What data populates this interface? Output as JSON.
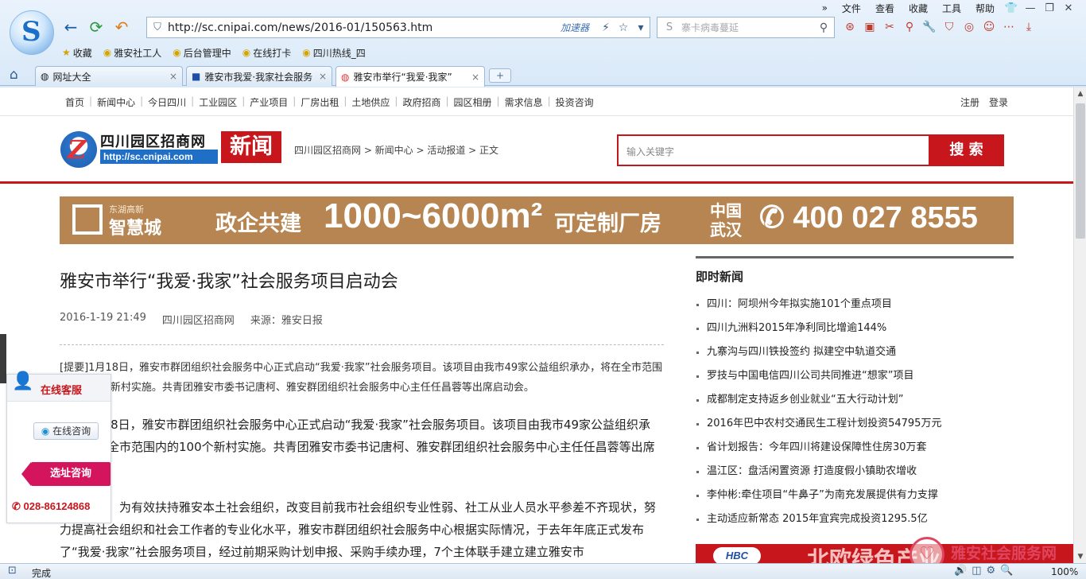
{
  "browser": {
    "menu": {
      "chevrons": "»",
      "file": "文件",
      "view": "查看",
      "favorites": "收藏",
      "tools": "工具",
      "help": "帮助"
    },
    "window_icons": {
      "skin": "👕",
      "minimize": "—",
      "restore": "❐",
      "close": "✕"
    },
    "nav": {
      "back": "←",
      "refresh": "⟳",
      "undo": "↶"
    },
    "address": {
      "url": "http://sc.cnipai.com/news/2016-01/150563.htm",
      "accelerator": "加速器",
      "bolt": "⚡",
      "star": "☆",
      "dropdown": "▾"
    },
    "search": {
      "placeholder": "寨卡病毒蔓延",
      "engine": "S"
    },
    "toolbar_icons": [
      "⊛",
      "▣",
      "✂",
      "⚲",
      "🔧",
      "⛉",
      "◎",
      "☺",
      "⋯",
      "⤓"
    ],
    "favorites_bar": [
      {
        "icon": "★",
        "label": "收藏"
      },
      {
        "icon": "◉",
        "label": "雅安社工人"
      },
      {
        "icon": "◉",
        "label": "后台管理中"
      },
      {
        "icon": "◉",
        "label": "在线打卡"
      },
      {
        "icon": "◉",
        "label": "四川热线_四"
      }
    ],
    "tabs": [
      {
        "icon": "◍",
        "label": "网址大全",
        "close": "×"
      },
      {
        "icon": "■",
        "label": "雅安市我爱·我家社会服务",
        "close": "×"
      },
      {
        "icon": "◍",
        "label": "雅安市举行“我爱·我家”",
        "close": "×"
      }
    ],
    "new_tab": "+",
    "home_icon": "⌂",
    "status": {
      "text": "完成",
      "zoom": "100%",
      "icons": [
        "🔊",
        "◫",
        "⚙",
        "🔍"
      ]
    }
  },
  "site": {
    "topnav": [
      "首页",
      "新闻中心",
      "今日四川",
      "工业园区",
      "产业项目",
      "厂房出租",
      "土地供应",
      "政府招商",
      "园区相册",
      "需求信息",
      "投资咨询"
    ],
    "register": "注册",
    "login": "登录",
    "brand": {
      "letter": "Z",
      "name": "四川园区招商网",
      "url": "http://sc.cnipai.com",
      "news": "新闻"
    },
    "breadcrumb": "四川园区招商网 > 新闻中心 > 活动报道 > 正文",
    "search": {
      "placeholder": "输入关键字",
      "button": "搜 索"
    },
    "banner": {
      "sub": "东湖高新",
      "name": "智慧城",
      "slogan": "政企共建",
      "area": "1000~6000m²",
      "custom": "可定制厂房",
      "location": "中国武汉",
      "phone": "✆ 400 027 8555"
    }
  },
  "article": {
    "title": "雅安市举行“我爱·我家”社会服务项目启动会",
    "date": "2016-1-19 21:49",
    "site": "四川园区招商网",
    "source": "来源：雅安日报",
    "summary_tag": "[提要]",
    "summary": "1月18日，雅安市群团组织社会服务中心正式启动“我爱·我家”社会服务项目。该项目由我市49家公益组织承办，将在全市范围内的100个新村实施。共青团雅安市委书记唐柯、雅安群团组织社会服务中心主任任昌蓉等出席启动会。",
    "p1": "1月18日，雅安市群团组织社会服务中心正式启动“我爱·我家”社会服务项目。该项目由我市49家公益组织承办，将在全市范围内的100个新村实施。共青团雅安市委书记唐柯、雅安群团组织社会服务中心主任任昌蓉等出席启动会。",
    "p2": "据悉，为有效扶持雅安本土社会组织，改变目前我市社会组织专业性弱、社工从业人员水平参差不齐现状，努力提高社会组织和社会工作者的专业化水平，雅安市群团组织社会服务中心根据实际情况，于去年年底正式发布了“我爱·我家”社会服务项目，经过前期采购计划申报、采购手续办理，7个主体联手建立建立雅安市"
  },
  "sidebar": {
    "heading": "即时新闻",
    "news": [
      "四川：阿坝州今年拟实施101个重点项目",
      "四川九洲料2015年净利同比增逾144%",
      "九寨沟与四川铁投签约 拟建空中轨道交通",
      "罗技与中国电信四川公司共同推进“想家”项目",
      "成都制定支持返乡创业就业“五大行动计划”",
      "2016年巴中农村交通民生工程计划投资54795万元",
      "省计划报告：今年四川将建设保障性住房30万套",
      "温江区：盘活闲置资源 打造度假小镇助农增收",
      "李仲彬:牵住项目“牛鼻子”为南充发展提供有力支撑",
      "主动适应新常态 2015年宜宾完成投资1295.5亿"
    ],
    "ad_logo": "HBC",
    "ad_text": "北欧绿色产业"
  },
  "watermark": {
    "icon": "♡",
    "text": "雅安社会服务网"
  },
  "chat": {
    "title": "在线客服",
    "consult": "在线咨询",
    "site_consult": "选址咨询",
    "phone": "028-86124868"
  }
}
